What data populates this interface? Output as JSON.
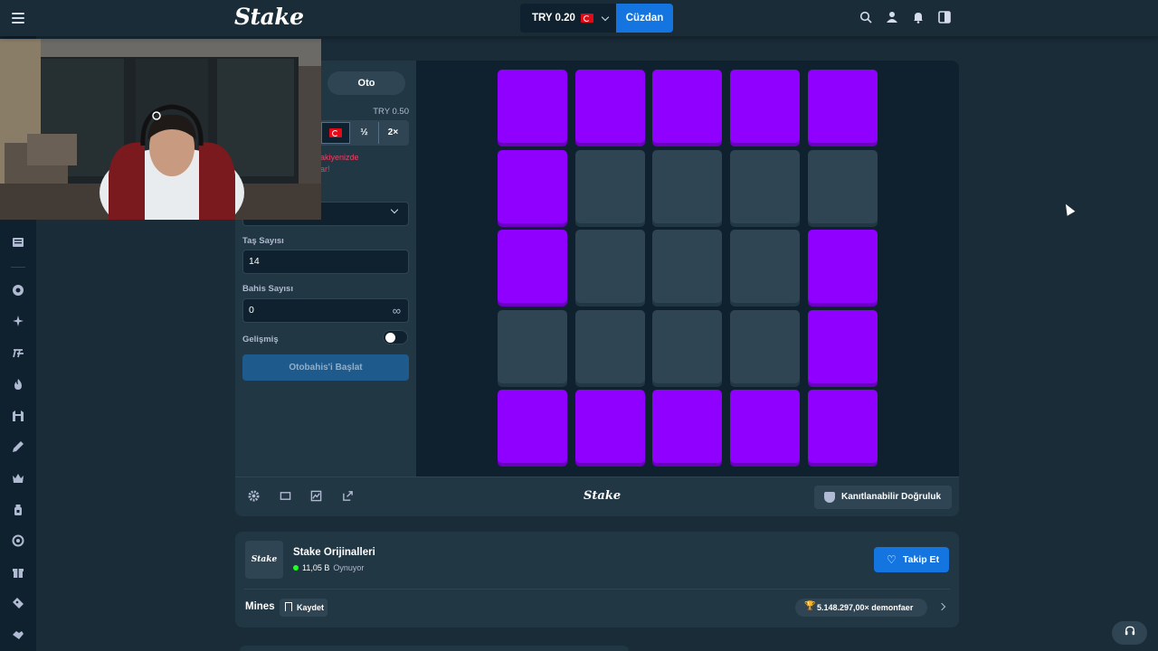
{
  "header": {
    "logo": "Stake",
    "balance": "TRY 0.20",
    "wallet_label": "Cüzdan",
    "icons": [
      "search-icon",
      "user-icon",
      "bell-icon",
      "sidebar-toggle-icon"
    ]
  },
  "sidebar": {
    "icons": [
      "menu-icon",
      "news-icon",
      "poker-chip-icon",
      "sparkle-icon",
      "sports-icon",
      "fire-icon",
      "stadium-icon",
      "pen-icon",
      "crown-icon",
      "jar-icon",
      "lifebuoy-icon",
      "gift-icon",
      "ticket-icon",
      "handshake-icon"
    ]
  },
  "panel": {
    "tab_auto": "Oto",
    "amount_value": "TRY 0.50",
    "half_label": "½",
    "double_label": "2×",
    "warning_line1": "akiyenizde",
    "warning_line2": "ar!",
    "mines_label": "Taş Sayısı",
    "mines_value": "14",
    "bets_label": "Bahis Sayısı",
    "bets_value": "0",
    "advanced_label": "Gelişmiş",
    "advanced_on": false,
    "start_button": "Otobahis'i Başlat"
  },
  "board": {
    "tiles": [
      "gem",
      "gem",
      "gem",
      "gem",
      "gem",
      "gem",
      "hidden",
      "hidden",
      "hidden",
      "hidden",
      "gem",
      "hidden",
      "hidden",
      "hidden",
      "gem",
      "hidden",
      "hidden",
      "hidden",
      "hidden",
      "gem",
      "gem",
      "gem",
      "gem",
      "gem",
      "gem"
    ],
    "gem_color": "#9000ff",
    "hidden_color": "#2f4553"
  },
  "footer": {
    "logo": "Stake",
    "fair_button": "Kanıtlanabilir Doğruluk",
    "icons": [
      "settings-icon",
      "theatre-icon",
      "stats-icon",
      "popout-icon"
    ]
  },
  "originals": {
    "logo": "Stake",
    "title": "Stake Orijinalleri",
    "players_count": "11,05 B",
    "players_label": "Oynuyor",
    "follow_button": "Takip Et",
    "game_title": "Mines",
    "save_button": "Kaydet",
    "record": "5.148.297,00× demonfaer"
  },
  "colors": {
    "accent": "#1475e1",
    "bg": "#1a2c38",
    "panel": "#213743",
    "dark": "#0f212e"
  }
}
